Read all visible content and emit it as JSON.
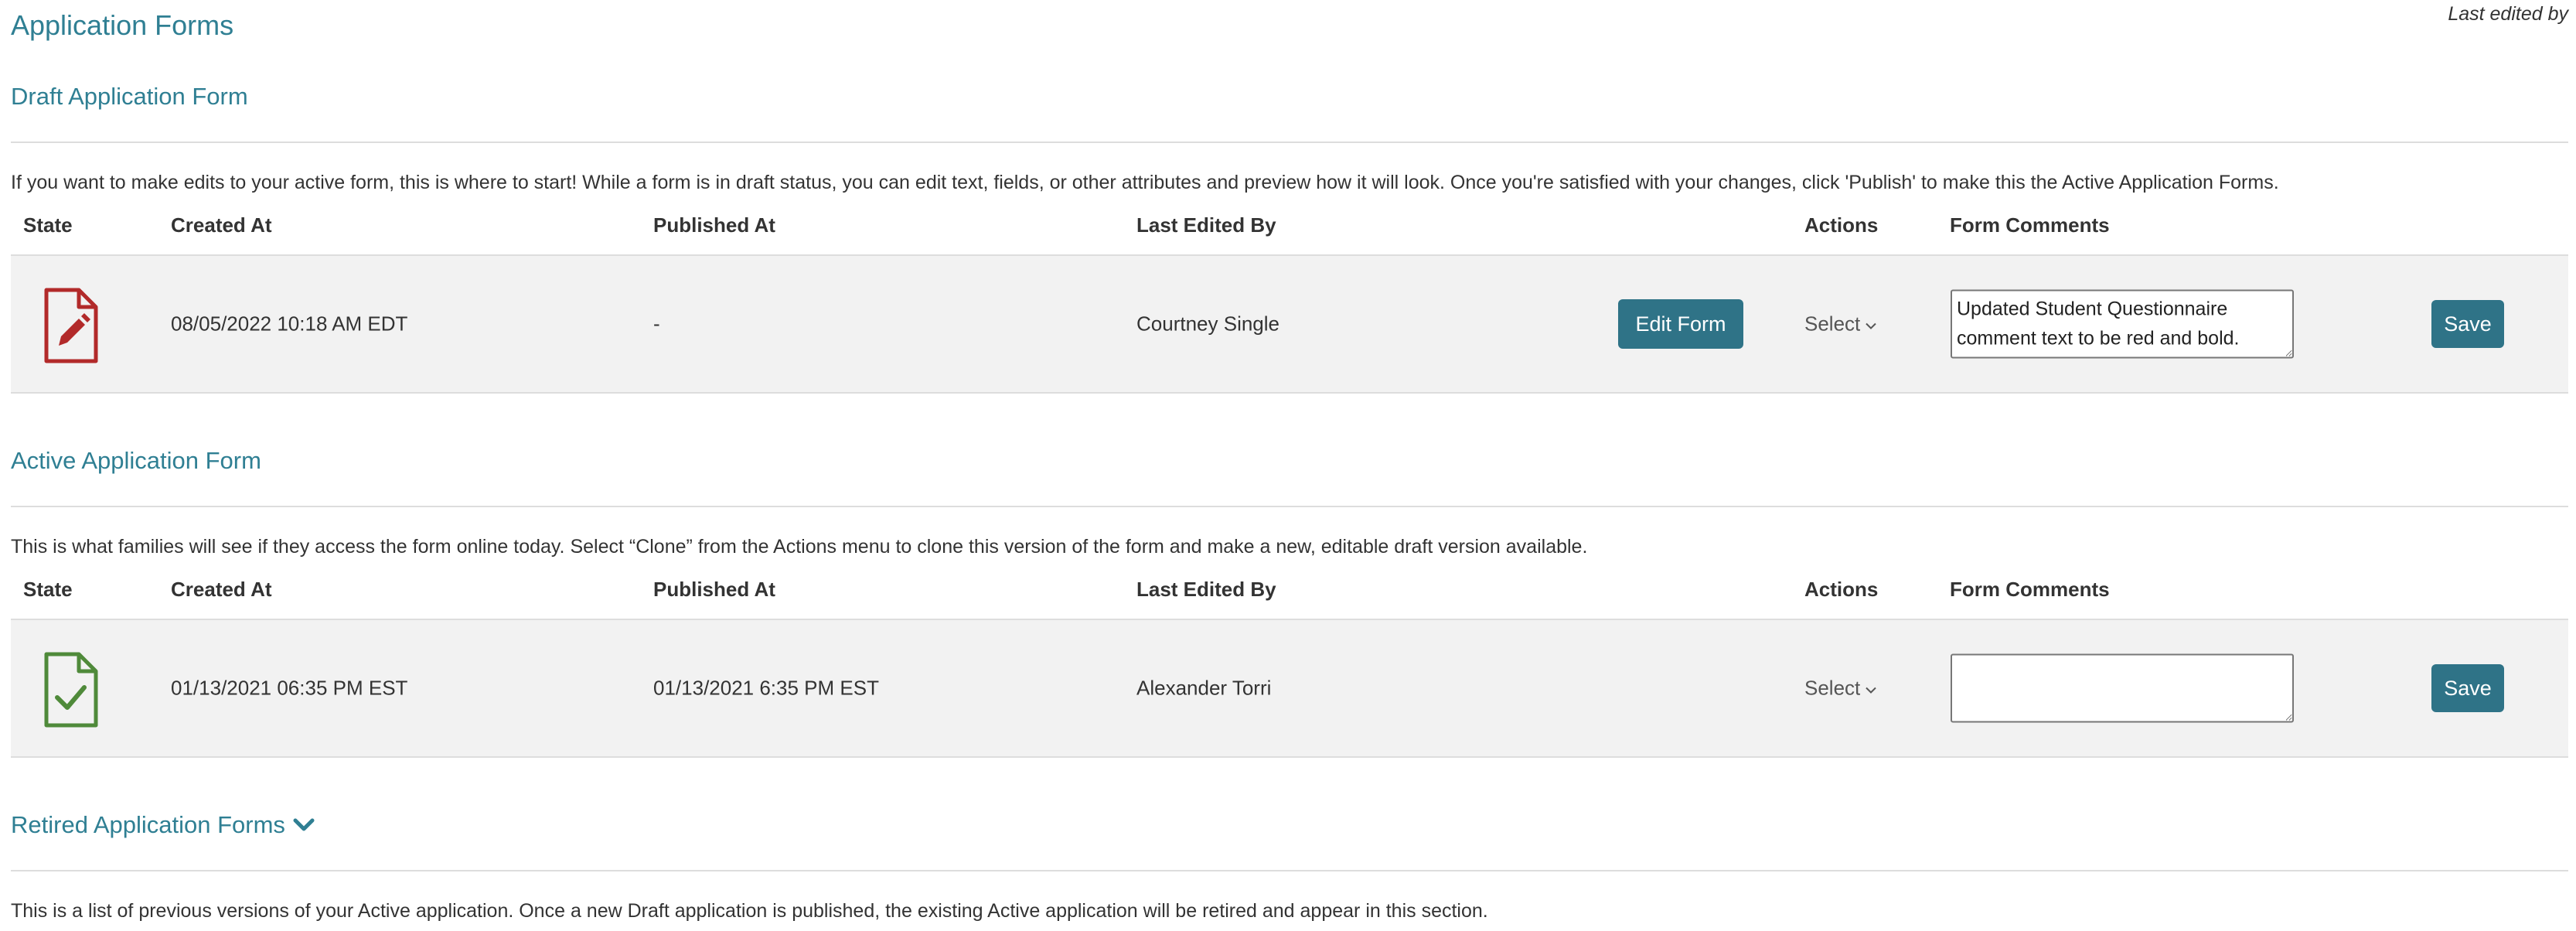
{
  "page_title": "Application Forms",
  "last_edited_by_label": "Last edited by",
  "draft": {
    "title": "Draft Application Form",
    "description": "If you want to make edits to your active form, this is where to start! While a form is in draft status, you can edit text, fields, or other attributes and preview how it will look. Once you're satisfied with your changes, click 'Publish' to make this the Active Application Forms.",
    "headers": [
      "State",
      "Created At",
      "Published At",
      "Last Edited By",
      "Actions",
      "Form Comments"
    ],
    "row": {
      "state_icon": "file-edit-icon",
      "created_at": "08/05/2022 10:18 AM EDT",
      "published_at": "-",
      "last_edited_by": "Courtney Single",
      "edit_button": "Edit Form",
      "actions_select": "Select",
      "comment": "Updated Student Questionnaire comment text to be red and bold.",
      "save_button": "Save"
    }
  },
  "active": {
    "title": "Active Application Form",
    "description": "This is what families will see if they access the form online today. Select “Clone” from the Actions menu to clone this version of the form and make a new, editable draft version available.",
    "headers": [
      "State",
      "Created At",
      "Published At",
      "Last Edited By",
      "Actions",
      "Form Comments"
    ],
    "row": {
      "state_icon": "file-check-icon",
      "created_at": "01/13/2021 06:35 PM EST",
      "published_at": "01/13/2021 6:35 PM EST",
      "last_edited_by": "Alexander Torri",
      "actions_select": "Select",
      "comment": "",
      "save_button": "Save"
    }
  },
  "retired": {
    "title": "Retired Application Forms",
    "description": "This is a list of previous versions of your Active application. Once a new Draft application is published, the existing Active application will be retired and appear in this section."
  },
  "colors": {
    "accent": "#2f7f93",
    "button": "#2f7387",
    "draft_icon": "#b22a2a",
    "active_icon": "#4f8a3a",
    "row_bg": "#f2f2f2"
  }
}
